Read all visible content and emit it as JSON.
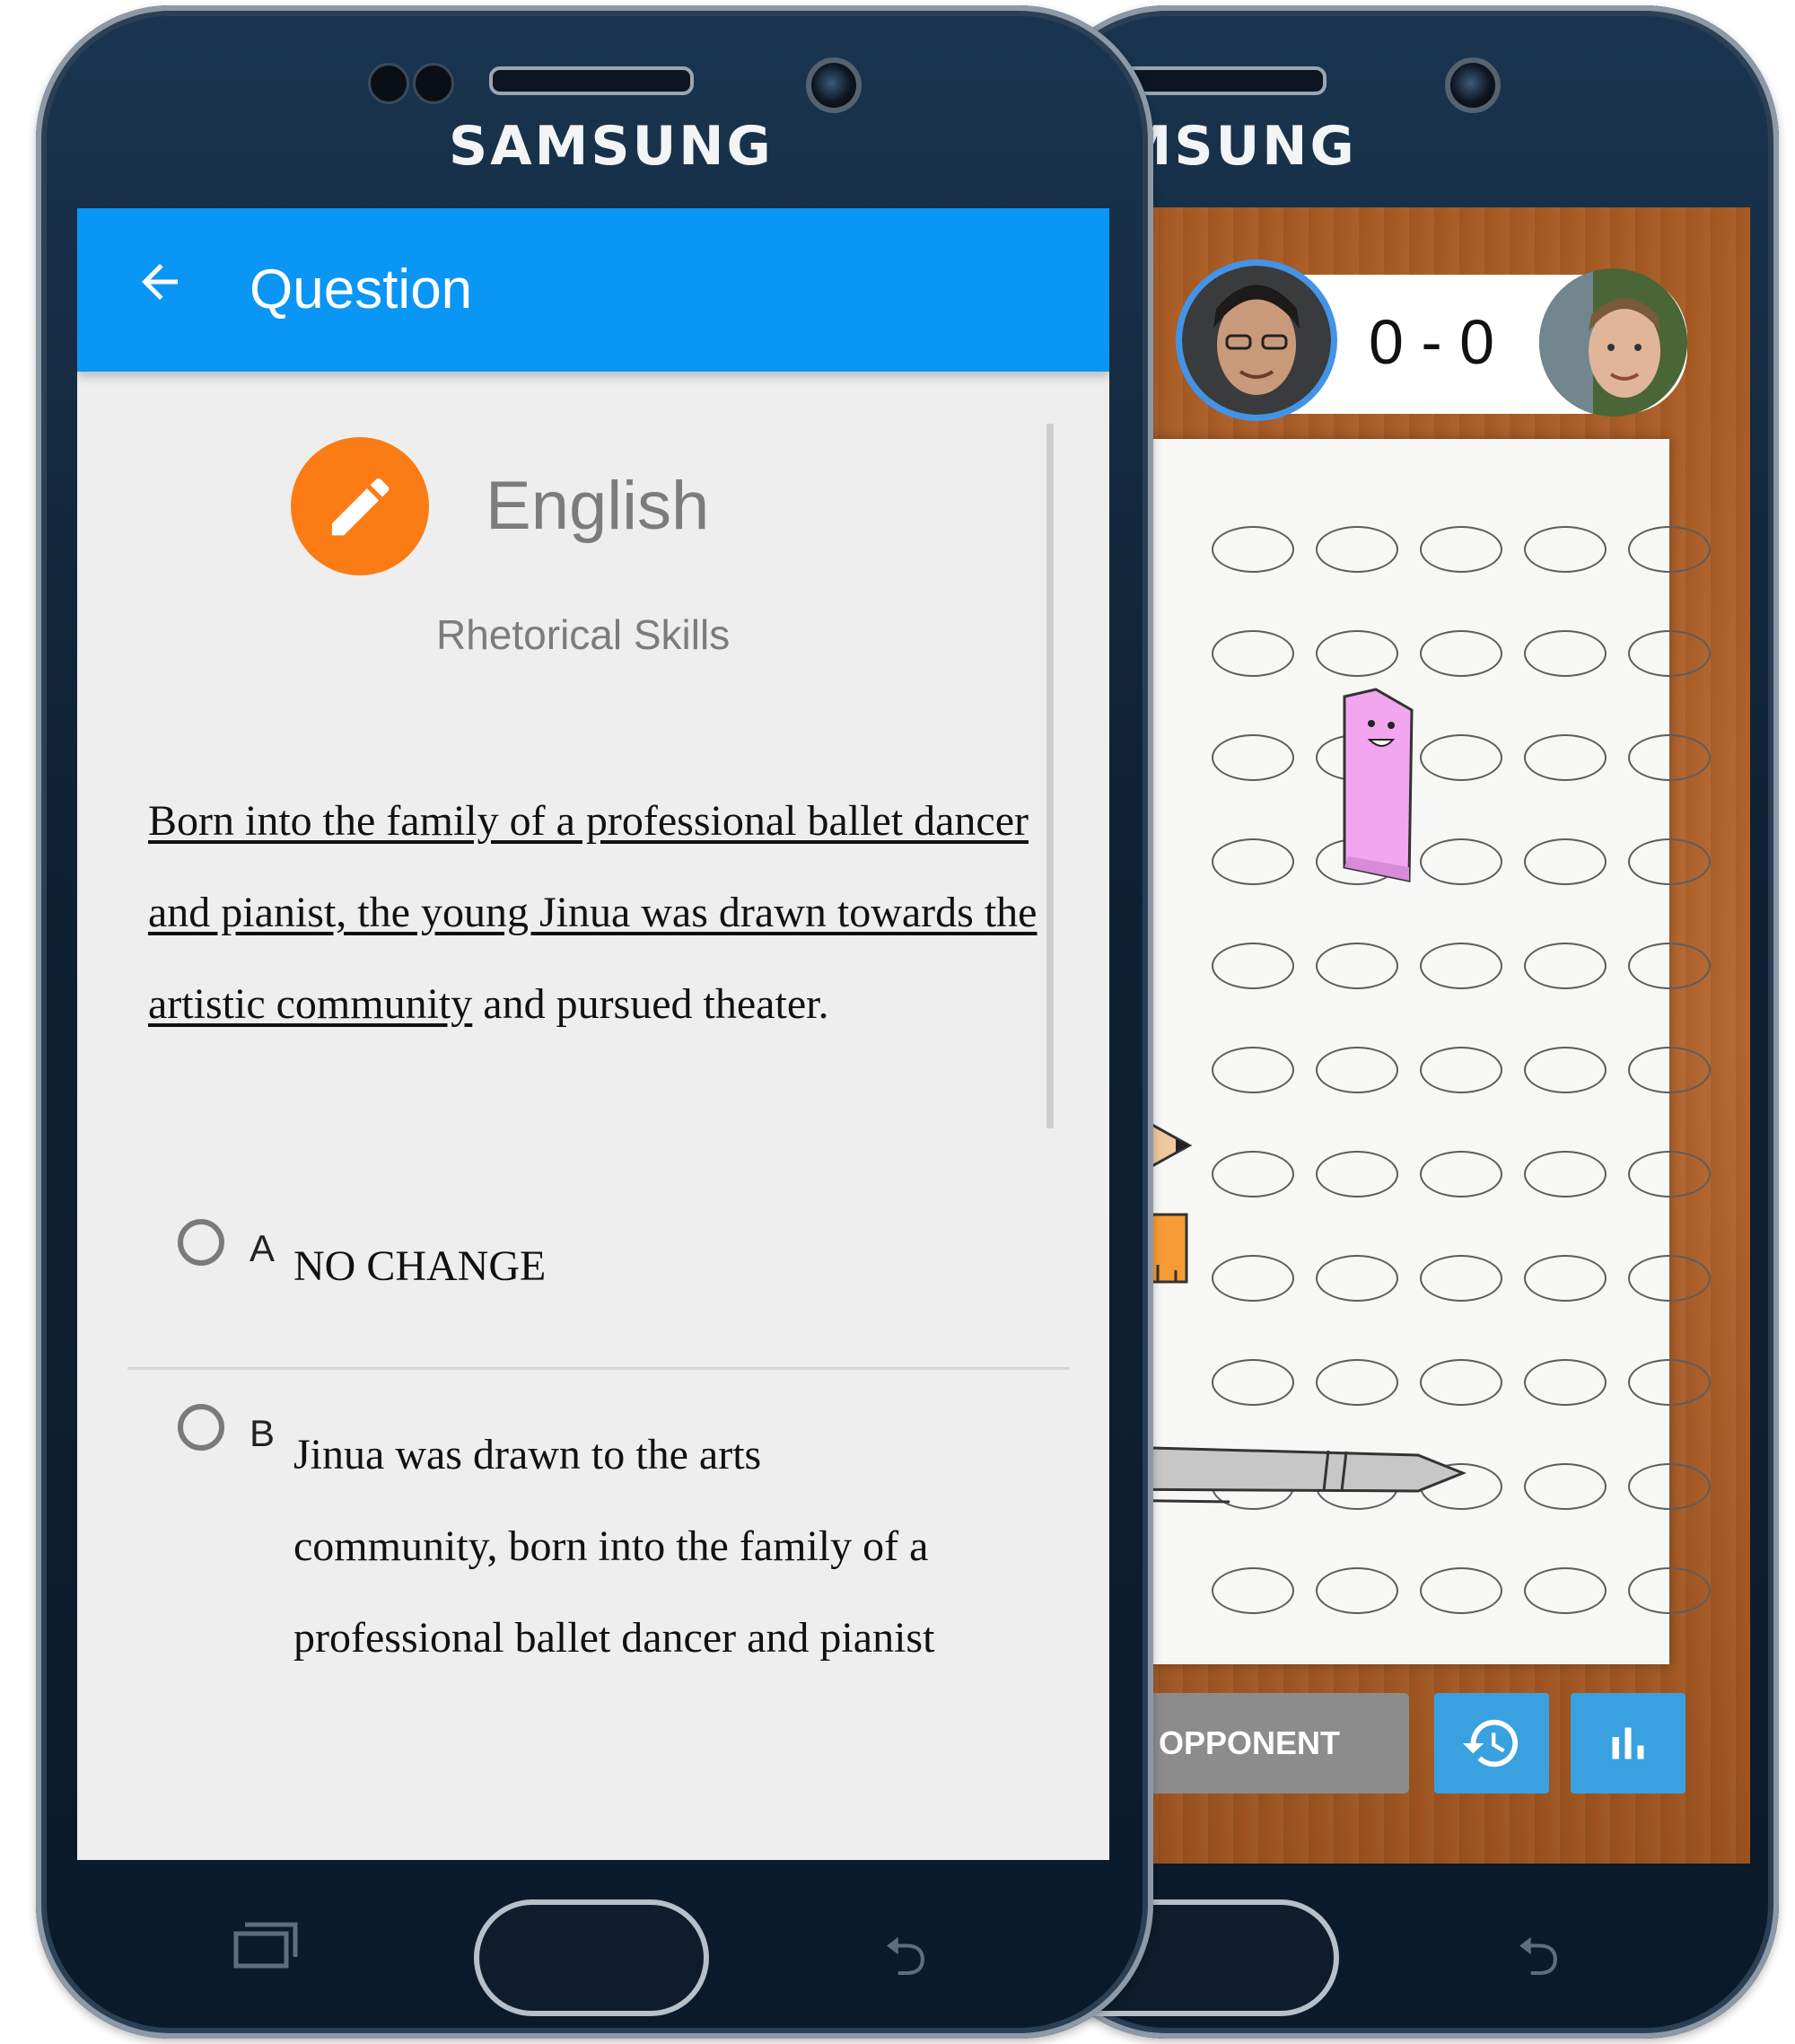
{
  "device": {
    "brand": "SAMSUNG",
    "back_glyph": "⮌"
  },
  "left_screen": {
    "appbar": {
      "title": "Question",
      "back_icon": "arrow-left"
    },
    "subject": {
      "icon": "pencil",
      "icon_color": "#fb7b14",
      "name": "English",
      "category": "Rhetorical Skills"
    },
    "passage": {
      "underlined": "Born into the family of a professional ballet dancer and pianist, the young Jinua was drawn towards the artistic community",
      "rest": " and pursued theater."
    },
    "choices": [
      {
        "letter": "A",
        "text": "NO CHANGE"
      },
      {
        "letter": "B",
        "text": "Jinua was drawn to the arts community, born into the family of a professional ballet dancer and pianist"
      }
    ],
    "appbar_color": "#0a96f5"
  },
  "right_screen": {
    "score": "0 - 0",
    "opponent_button": "OR OPPONENT",
    "history_icon": "history",
    "stats_icon": "bar-chart",
    "button_color": "#3aa1e0"
  }
}
